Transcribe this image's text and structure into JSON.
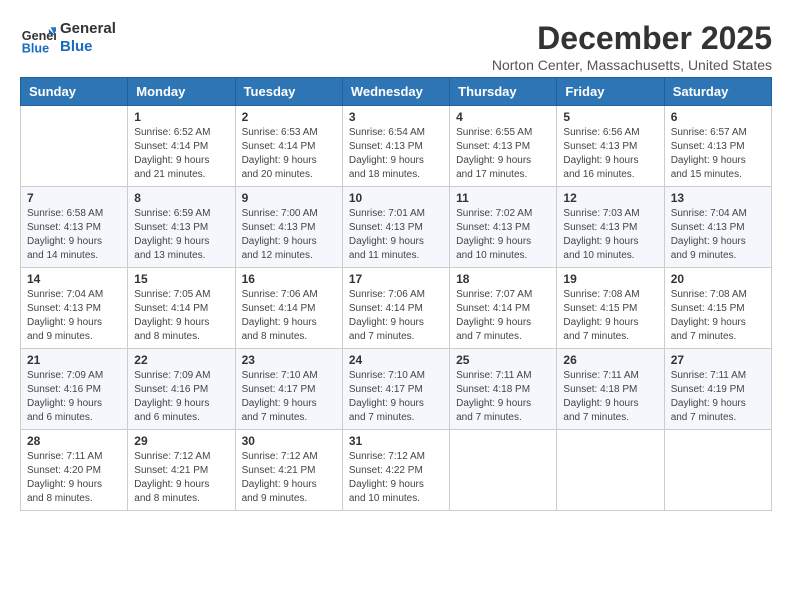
{
  "header": {
    "logo_line1": "General",
    "logo_line2": "Blue",
    "month": "December 2025",
    "location": "Norton Center, Massachusetts, United States"
  },
  "weekdays": [
    "Sunday",
    "Monday",
    "Tuesday",
    "Wednesday",
    "Thursday",
    "Friday",
    "Saturday"
  ],
  "weeks": [
    [
      {
        "day": "",
        "info": ""
      },
      {
        "day": "1",
        "info": "Sunrise: 6:52 AM\nSunset: 4:14 PM\nDaylight: 9 hours\nand 21 minutes."
      },
      {
        "day": "2",
        "info": "Sunrise: 6:53 AM\nSunset: 4:14 PM\nDaylight: 9 hours\nand 20 minutes."
      },
      {
        "day": "3",
        "info": "Sunrise: 6:54 AM\nSunset: 4:13 PM\nDaylight: 9 hours\nand 18 minutes."
      },
      {
        "day": "4",
        "info": "Sunrise: 6:55 AM\nSunset: 4:13 PM\nDaylight: 9 hours\nand 17 minutes."
      },
      {
        "day": "5",
        "info": "Sunrise: 6:56 AM\nSunset: 4:13 PM\nDaylight: 9 hours\nand 16 minutes."
      },
      {
        "day": "6",
        "info": "Sunrise: 6:57 AM\nSunset: 4:13 PM\nDaylight: 9 hours\nand 15 minutes."
      }
    ],
    [
      {
        "day": "7",
        "info": "Sunrise: 6:58 AM\nSunset: 4:13 PM\nDaylight: 9 hours\nand 14 minutes."
      },
      {
        "day": "8",
        "info": "Sunrise: 6:59 AM\nSunset: 4:13 PM\nDaylight: 9 hours\nand 13 minutes."
      },
      {
        "day": "9",
        "info": "Sunrise: 7:00 AM\nSunset: 4:13 PM\nDaylight: 9 hours\nand 12 minutes."
      },
      {
        "day": "10",
        "info": "Sunrise: 7:01 AM\nSunset: 4:13 PM\nDaylight: 9 hours\nand 11 minutes."
      },
      {
        "day": "11",
        "info": "Sunrise: 7:02 AM\nSunset: 4:13 PM\nDaylight: 9 hours\nand 10 minutes."
      },
      {
        "day": "12",
        "info": "Sunrise: 7:03 AM\nSunset: 4:13 PM\nDaylight: 9 hours\nand 10 minutes."
      },
      {
        "day": "13",
        "info": "Sunrise: 7:04 AM\nSunset: 4:13 PM\nDaylight: 9 hours\nand 9 minutes."
      }
    ],
    [
      {
        "day": "14",
        "info": "Sunrise: 7:04 AM\nSunset: 4:13 PM\nDaylight: 9 hours\nand 9 minutes."
      },
      {
        "day": "15",
        "info": "Sunrise: 7:05 AM\nSunset: 4:14 PM\nDaylight: 9 hours\nand 8 minutes."
      },
      {
        "day": "16",
        "info": "Sunrise: 7:06 AM\nSunset: 4:14 PM\nDaylight: 9 hours\nand 8 minutes."
      },
      {
        "day": "17",
        "info": "Sunrise: 7:06 AM\nSunset: 4:14 PM\nDaylight: 9 hours\nand 7 minutes."
      },
      {
        "day": "18",
        "info": "Sunrise: 7:07 AM\nSunset: 4:14 PM\nDaylight: 9 hours\nand 7 minutes."
      },
      {
        "day": "19",
        "info": "Sunrise: 7:08 AM\nSunset: 4:15 PM\nDaylight: 9 hours\nand 7 minutes."
      },
      {
        "day": "20",
        "info": "Sunrise: 7:08 AM\nSunset: 4:15 PM\nDaylight: 9 hours\nand 7 minutes."
      }
    ],
    [
      {
        "day": "21",
        "info": "Sunrise: 7:09 AM\nSunset: 4:16 PM\nDaylight: 9 hours\nand 6 minutes."
      },
      {
        "day": "22",
        "info": "Sunrise: 7:09 AM\nSunset: 4:16 PM\nDaylight: 9 hours\nand 6 minutes."
      },
      {
        "day": "23",
        "info": "Sunrise: 7:10 AM\nSunset: 4:17 PM\nDaylight: 9 hours\nand 7 minutes."
      },
      {
        "day": "24",
        "info": "Sunrise: 7:10 AM\nSunset: 4:17 PM\nDaylight: 9 hours\nand 7 minutes."
      },
      {
        "day": "25",
        "info": "Sunrise: 7:11 AM\nSunset: 4:18 PM\nDaylight: 9 hours\nand 7 minutes."
      },
      {
        "day": "26",
        "info": "Sunrise: 7:11 AM\nSunset: 4:18 PM\nDaylight: 9 hours\nand 7 minutes."
      },
      {
        "day": "27",
        "info": "Sunrise: 7:11 AM\nSunset: 4:19 PM\nDaylight: 9 hours\nand 7 minutes."
      }
    ],
    [
      {
        "day": "28",
        "info": "Sunrise: 7:11 AM\nSunset: 4:20 PM\nDaylight: 9 hours\nand 8 minutes."
      },
      {
        "day": "29",
        "info": "Sunrise: 7:12 AM\nSunset: 4:21 PM\nDaylight: 9 hours\nand 8 minutes."
      },
      {
        "day": "30",
        "info": "Sunrise: 7:12 AM\nSunset: 4:21 PM\nDaylight: 9 hours\nand 9 minutes."
      },
      {
        "day": "31",
        "info": "Sunrise: 7:12 AM\nSunset: 4:22 PM\nDaylight: 9 hours\nand 10 minutes."
      },
      {
        "day": "",
        "info": ""
      },
      {
        "day": "",
        "info": ""
      },
      {
        "day": "",
        "info": ""
      }
    ]
  ]
}
